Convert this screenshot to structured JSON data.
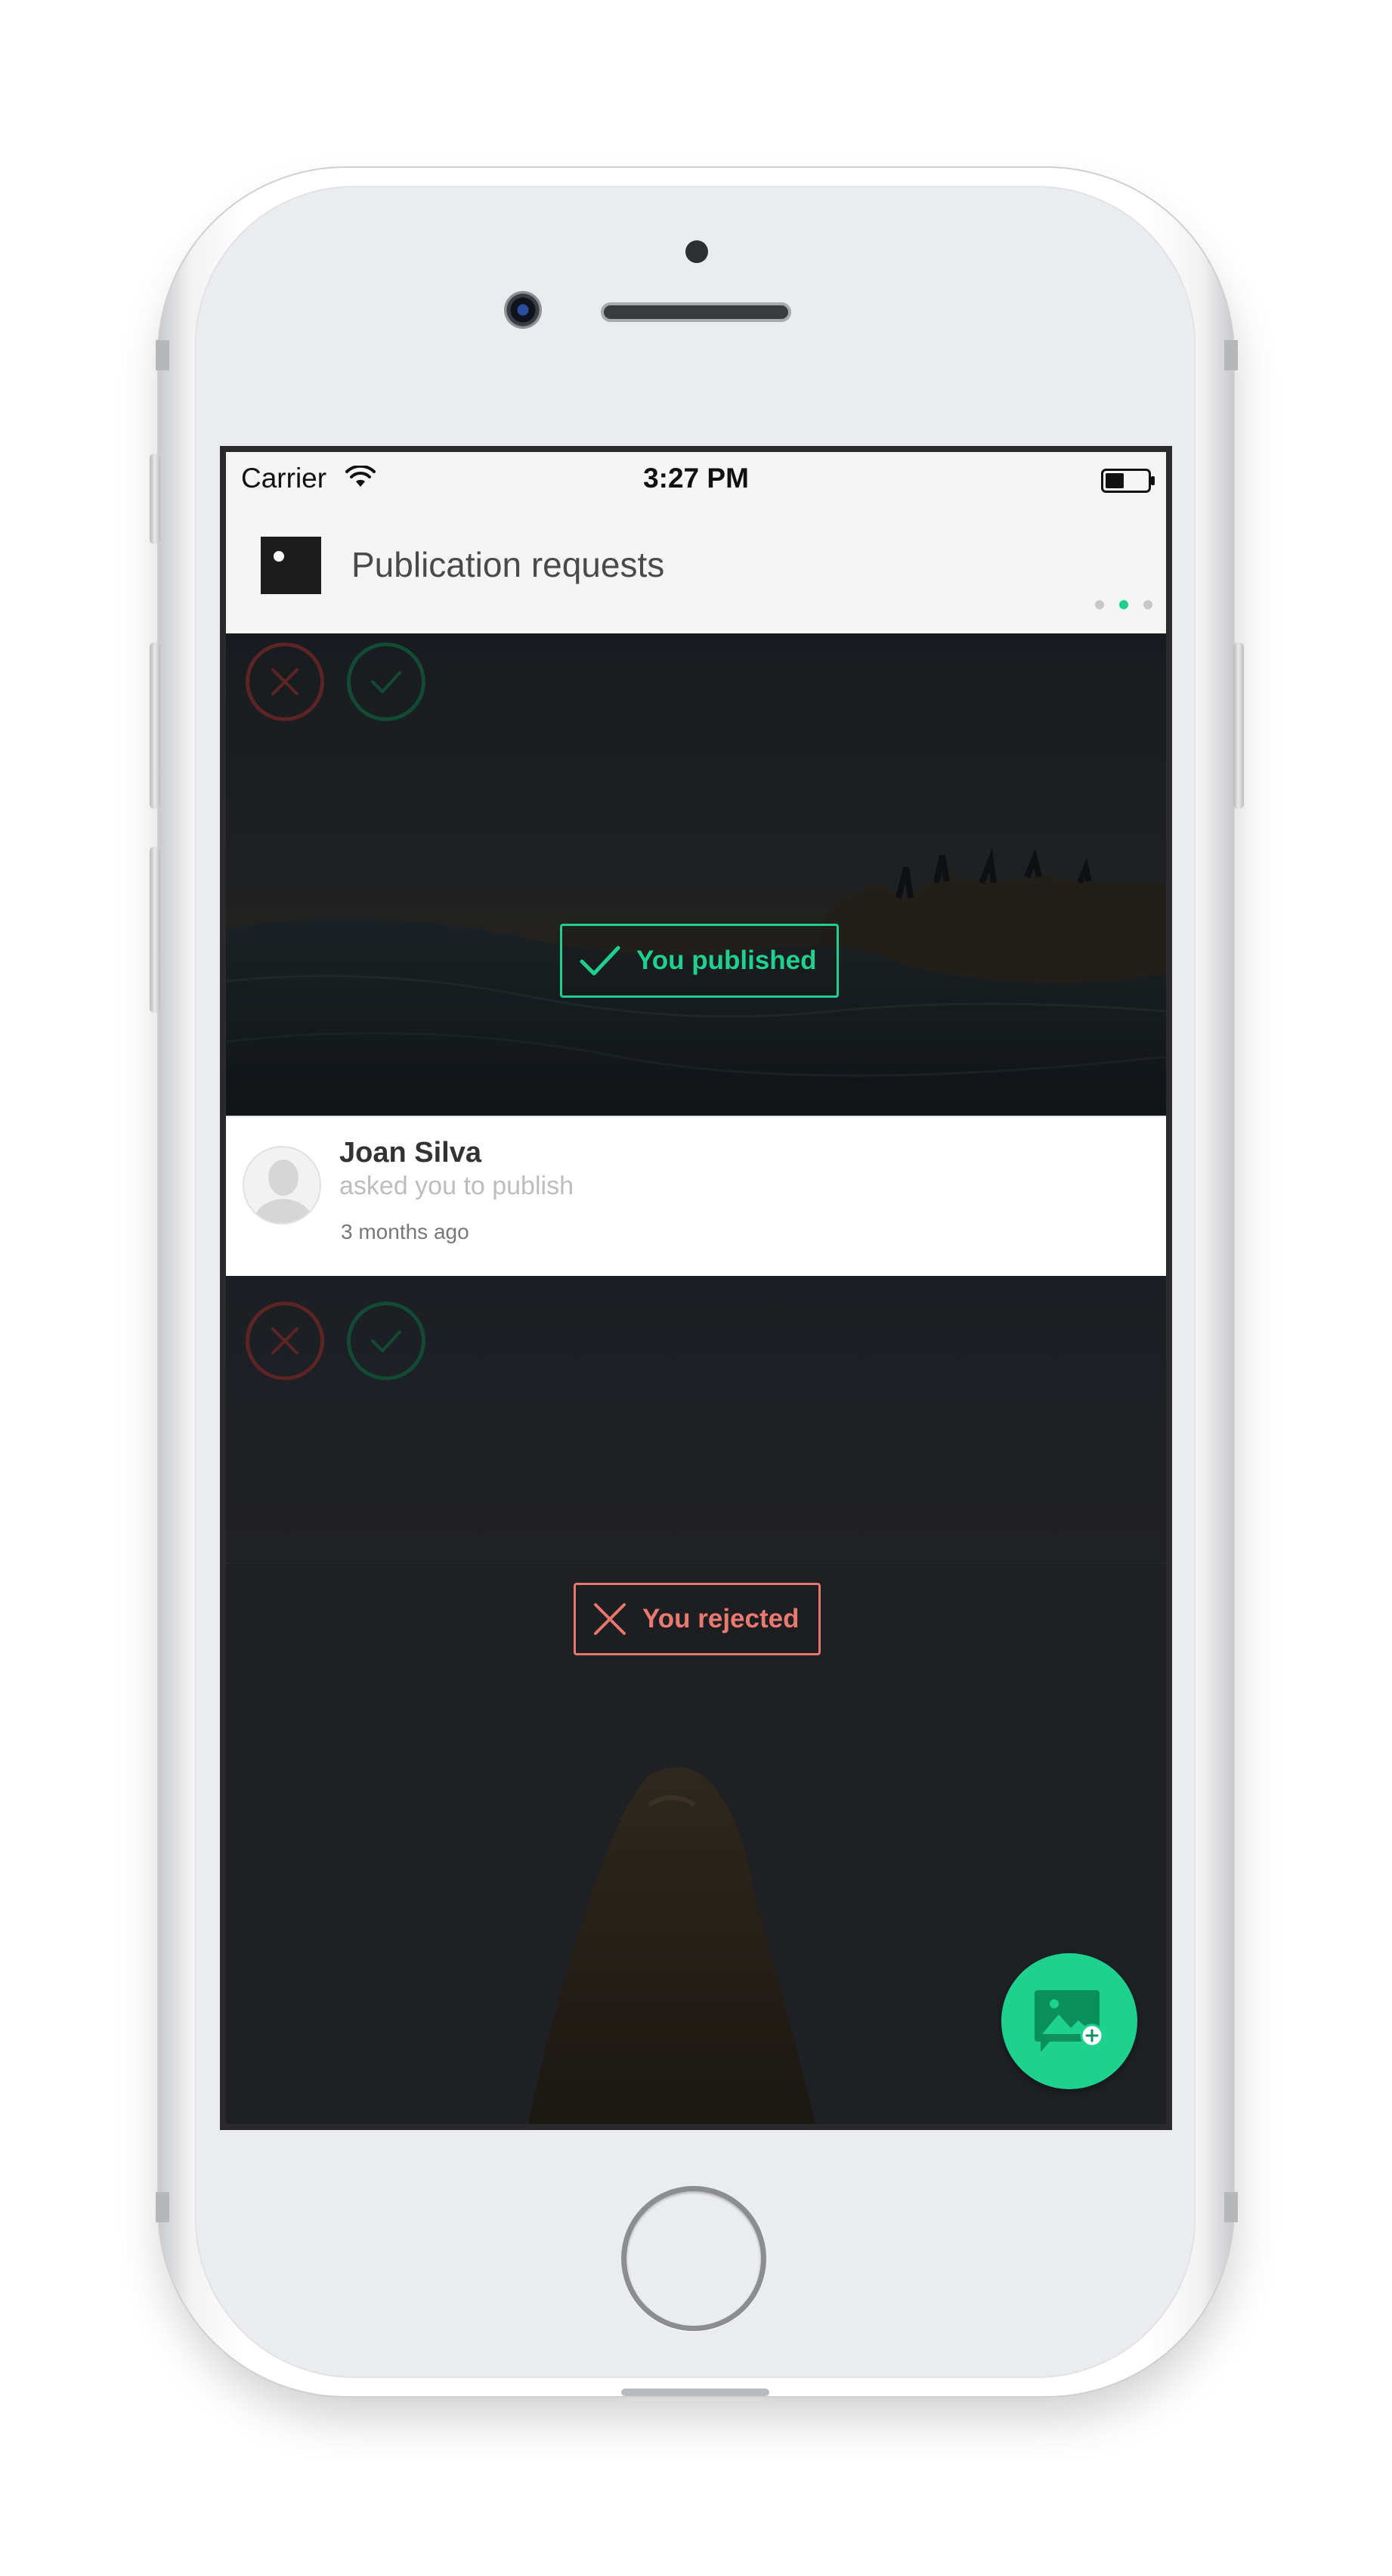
{
  "status_bar": {
    "carrier": "Carrier",
    "time": "3:27 PM"
  },
  "header": {
    "title": "Publication requests",
    "icon": "image-icon",
    "pages": 3,
    "active_page": 2
  },
  "cards": [
    {
      "status": "You published",
      "status_color": "#1fcf8e",
      "actions": [
        "reject",
        "approve"
      ]
    },
    {
      "status": "You rejected",
      "status_color": "#e8766d",
      "actions": [
        "reject",
        "approve"
      ]
    }
  ],
  "request": {
    "name": "Joan Silva",
    "text": "asked you to publish",
    "time": "3 months ago"
  },
  "fab": {
    "icon": "add-image-icon",
    "color": "#1fd18f"
  },
  "colors": {
    "accent_green": "#1fcf8e",
    "reject_red": "#e8766d"
  }
}
